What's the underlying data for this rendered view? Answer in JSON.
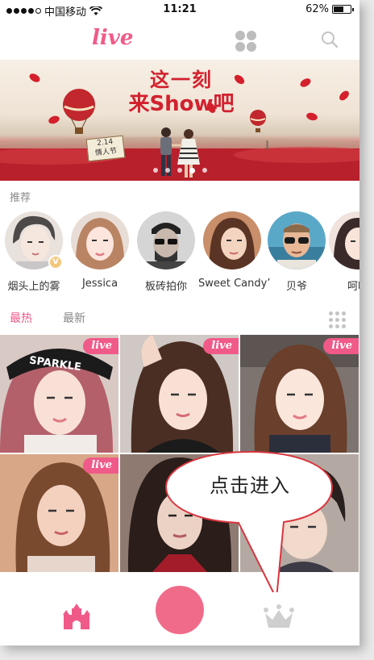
{
  "status_bar": {
    "carrier": "中国移动",
    "time": "11:21",
    "battery": "62%",
    "battery_level": 0.62
  },
  "nav": {
    "logo": "live",
    "icons": [
      "grid-icon",
      "search-icon"
    ]
  },
  "banner": {
    "title_line1": "这一刻",
    "title_line2": "来Show吧",
    "sign_line1": "2.14",
    "sign_line2": "情人节",
    "dots": 5,
    "active_dot": 3
  },
  "recommend": {
    "label": "推荐",
    "users": [
      {
        "name": "烟头上的雾"
      },
      {
        "name": "Jessica"
      },
      {
        "name": "板砖拍你"
      },
      {
        "name": "Sweet Candy’"
      },
      {
        "name": "贝爷"
      },
      {
        "name": "呵呵"
      }
    ]
  },
  "tabs": {
    "hot": "最热",
    "new": "最新"
  },
  "feed": {
    "live_label": "live"
  },
  "callout": {
    "text": "点击进入"
  },
  "colors": {
    "accent": "#f05a89",
    "go_live": "#f06b8a",
    "icon_gray": "#c4c4c4"
  }
}
